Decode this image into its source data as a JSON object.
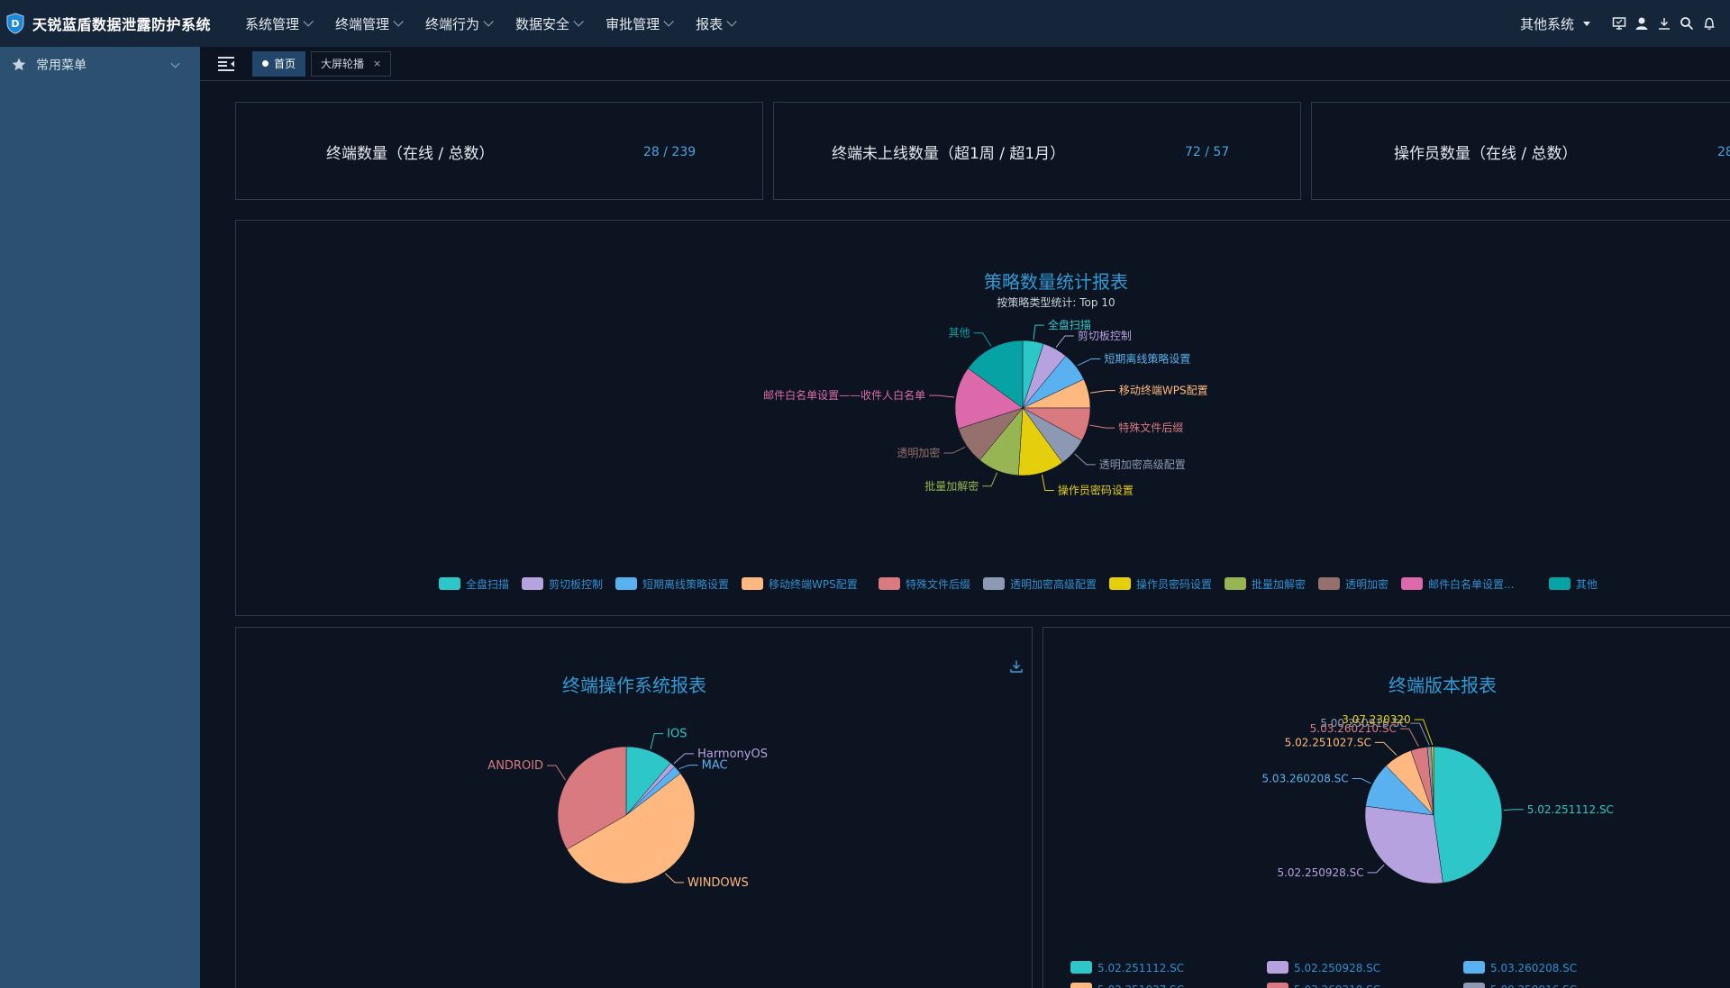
{
  "app": {
    "title": "天锐蓝盾数据泄露防护系统"
  },
  "menu": [
    {
      "label": "系统管理"
    },
    {
      "label": "终端管理"
    },
    {
      "label": "终端行为"
    },
    {
      "label": "数据安全"
    },
    {
      "label": "审批管理"
    },
    {
      "label": "报表"
    }
  ],
  "topright": {
    "other_systems": "其他系统",
    "icons": [
      "monitor-icon",
      "user-icon",
      "download-icon",
      "search-icon",
      "bell-icon"
    ]
  },
  "sidebar": {
    "items": [
      {
        "label": "常用菜单",
        "icon": "star-icon"
      }
    ]
  },
  "tabs": [
    {
      "label": "首页",
      "active": true
    },
    {
      "label": "大屏轮播",
      "closable": true,
      "close": "×"
    }
  ],
  "stats": [
    {
      "label": "终端数量（在线 / 总数）",
      "value": "28  /  239"
    },
    {
      "label": "终端未上线数量（超1周 / 超1月）",
      "value": "72  /  57"
    },
    {
      "label": "操作员数量（在线 / 总数）",
      "value": "28"
    }
  ],
  "chart_data": [
    {
      "type": "pie",
      "title": "策略数量统计报表",
      "subtitle": "按策略类型统计: Top 10",
      "categories": [
        "全盘扫描",
        "剪切板控制",
        "短期离线策略设置",
        "移动终端WPS配置",
        "特殊文件后缀",
        "透明加密高级配置",
        "操作员密码设置",
        "批量加解密",
        "透明加密",
        "邮件白名单设置——收件人白名单",
        "其他"
      ],
      "legend": [
        "全盘扫描",
        "剪切板控制",
        "短期离线策略设置",
        "移动终端WPS配置",
        "特殊文件后缀",
        "透明加密高级配置",
        "操作员密码设置",
        "批量加解密",
        "透明加密",
        "邮件白名单设置...",
        "其他"
      ],
      "values": [
        5,
        6,
        7,
        7,
        8,
        7,
        11,
        10,
        9,
        15,
        15
      ],
      "colors": [
        "#2ec7c9",
        "#b6a2de",
        "#5ab1ef",
        "#ffb980",
        "#d87a80",
        "#8d98b3",
        "#e5cf0d",
        "#97b552",
        "#95706d",
        "#dc69aa",
        "#07a2a4"
      ],
      "legend_position": "bottom"
    },
    {
      "type": "pie",
      "title": "终端操作系统报表",
      "categories": [
        "IOS",
        "HarmonyOS",
        "MAC",
        "WINDOWS",
        "ANDROID"
      ],
      "values": [
        27,
        3,
        5,
        125,
        80
      ],
      "colors": [
        "#2ec7c9",
        "#b6a2de",
        "#5ab1ef",
        "#ffb980",
        "#d87a80"
      ],
      "legend_position": "none"
    },
    {
      "type": "pie",
      "title": "终端版本报表",
      "categories": [
        "5.02.251112.SC",
        "5.02.250928.SC",
        "5.03.260208.SC",
        "5.02.251027.SC",
        "5.03.260210.SC",
        "5.00.250916.SC",
        "3.07.230320"
      ],
      "values": [
        98,
        60,
        22,
        14,
        8,
        2,
        1
      ],
      "colors": [
        "#2ec7c9",
        "#b6a2de",
        "#5ab1ef",
        "#ffb980",
        "#d87a80",
        "#8d98b3",
        "#e5cf0d"
      ],
      "legend_position": "bottom"
    }
  ]
}
